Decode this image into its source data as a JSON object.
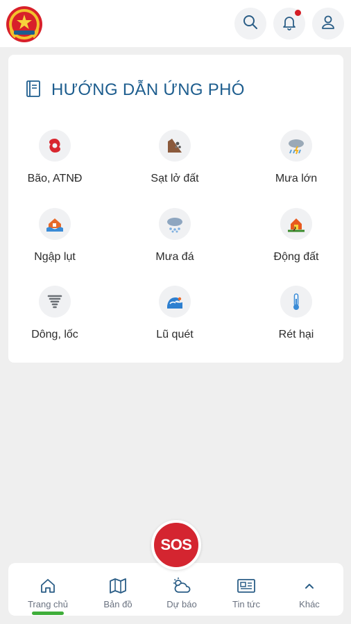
{
  "header": {
    "logo": "emblem-logo",
    "buttons": [
      {
        "name": "search-button",
        "icon": "search-icon"
      },
      {
        "name": "notification-button",
        "icon": "bell-icon",
        "has_badge": true
      },
      {
        "name": "profile-button",
        "icon": "user-icon"
      }
    ]
  },
  "guide": {
    "title": "HƯỚNG DẪN ỨNG PHÓ",
    "title_icon": "book-icon",
    "items": [
      {
        "label": "Bão, ATNĐ",
        "icon": "typhoon-icon"
      },
      {
        "label": "Sạt lở đất",
        "icon": "landslide-icon"
      },
      {
        "label": "Mưa lớn",
        "icon": "heavy-rain-icon"
      },
      {
        "label": "Ngập lụt",
        "icon": "flood-icon"
      },
      {
        "label": "Mưa đá",
        "icon": "hail-icon"
      },
      {
        "label": "Động đất",
        "icon": "earthquake-icon"
      },
      {
        "label": "Dông, lốc",
        "icon": "tornado-icon"
      },
      {
        "label": "Lũ quét",
        "icon": "flash-flood-icon"
      },
      {
        "label": "Rét hại",
        "icon": "thermometer-icon"
      }
    ]
  },
  "sos": {
    "label": "SOS"
  },
  "nav": {
    "items": [
      {
        "label": "Trang chủ",
        "icon": "home-icon",
        "active": true
      },
      {
        "label": "Bản đồ",
        "icon": "map-icon"
      },
      {
        "label": "Dự báo",
        "icon": "weather-icon"
      },
      {
        "label": "Tin tức",
        "icon": "news-icon"
      },
      {
        "label": "Khác",
        "icon": "chevron-up-icon"
      }
    ]
  },
  "colors": {
    "accent": "#1d5d8e",
    "sos": "#d42530",
    "active_indicator": "#3fae3a",
    "badge": "#d41c24"
  }
}
